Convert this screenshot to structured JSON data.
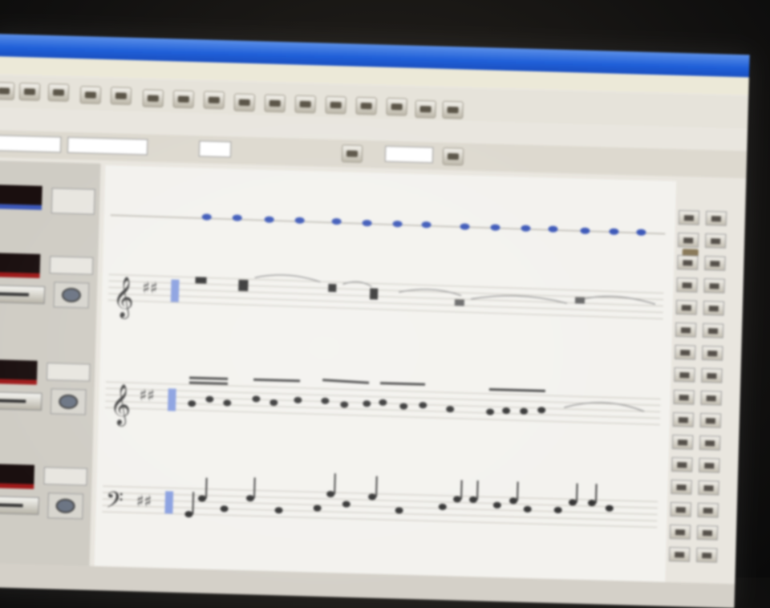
{
  "window": {
    "title": ""
  },
  "menu": {
    "items": []
  },
  "icons": {
    "toolbar": [
      "note-icon",
      "rest-icon",
      "tie-icon",
      "play-icon",
      "stop-icon",
      "record-icon"
    ],
    "track_knob": "pan-knob-icon",
    "clefs": [
      "treble-clef-icon",
      "treble-clef-icon",
      "bass-clef-icon"
    ]
  },
  "colors": {
    "titlebar": "#1f5fd8",
    "meter_red": "#9e1a1a",
    "meter_blue": "#3c58b8",
    "selected_note": "#3c58b8"
  },
  "score": {
    "staves": [
      {
        "name": "",
        "clef": "percussion"
      },
      {
        "name": "",
        "clef": "treble"
      },
      {
        "name": "",
        "clef": "treble"
      },
      {
        "name": "",
        "clef": "bass"
      }
    ]
  }
}
